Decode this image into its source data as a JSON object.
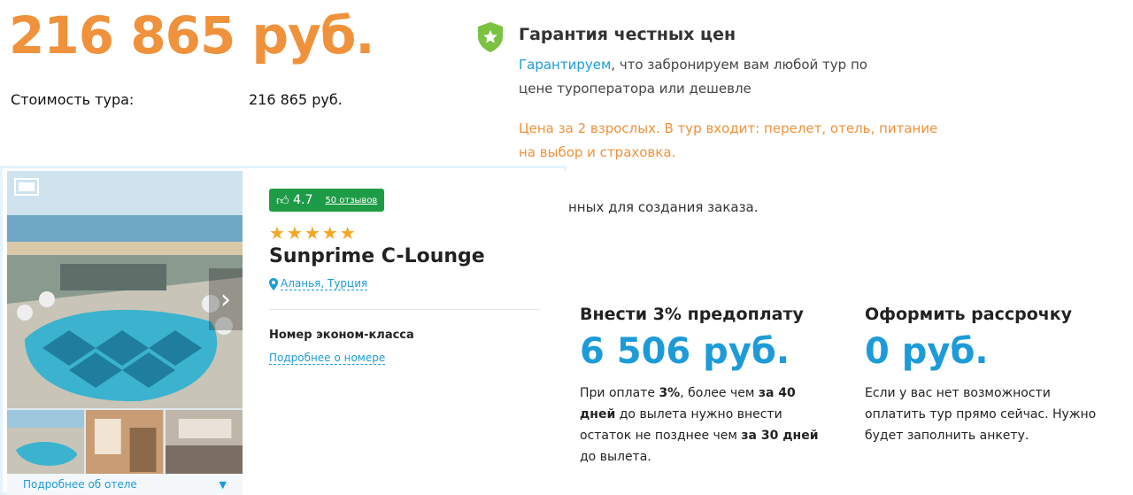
{
  "price": {
    "big": "216 865 руб.",
    "cost_label": "Стоимость тура:",
    "cost_value": "216 865 руб."
  },
  "guarantee": {
    "title": "Гарантия честных цен",
    "link": "Гарантируем",
    "text": ", что забронируем вам любой тур по цене туроператора или дешевле",
    "includes": "Цена за 2 взрослых. В тур входит: перелет, отель, питание на выбор и страховка.",
    "cut_text": "нных для создания заказа.",
    "icon": "shield-star-icon",
    "icon_color": "#7cc242"
  },
  "hotel": {
    "rating": "4.7",
    "reviews": "50 отзывов",
    "stars": "★★★★★",
    "name": "Sunprime C-Lounge",
    "location": "Аланья, Турция",
    "room_type": "Номер эконом-класса",
    "room_more": "Подробнее о номере",
    "hotel_more": "Подробнее об отеле"
  },
  "payments": {
    "prepay": {
      "title": "Внести 3% предоплату",
      "amount": "6 506 руб.",
      "d1": "При оплате ",
      "d2": "3%",
      "d3": ", более чем ",
      "d4": "за 40 дней",
      "d5": " до вылета нужно внести остаток не позднее чем ",
      "d6": "за 30 дней",
      "d7": " до вылета."
    },
    "installment": {
      "title": "Оформить рассрочку",
      "amount": "0 руб.",
      "desc": "Если у вас нет возможности оплатить тур прямо сейчас. Нужно будет заполнить анкету."
    }
  },
  "colors": {
    "accent_orange": "#f0923c",
    "accent_blue": "#1d9bd8",
    "rating_green": "#1e9b46",
    "stars": "#f5a623"
  }
}
